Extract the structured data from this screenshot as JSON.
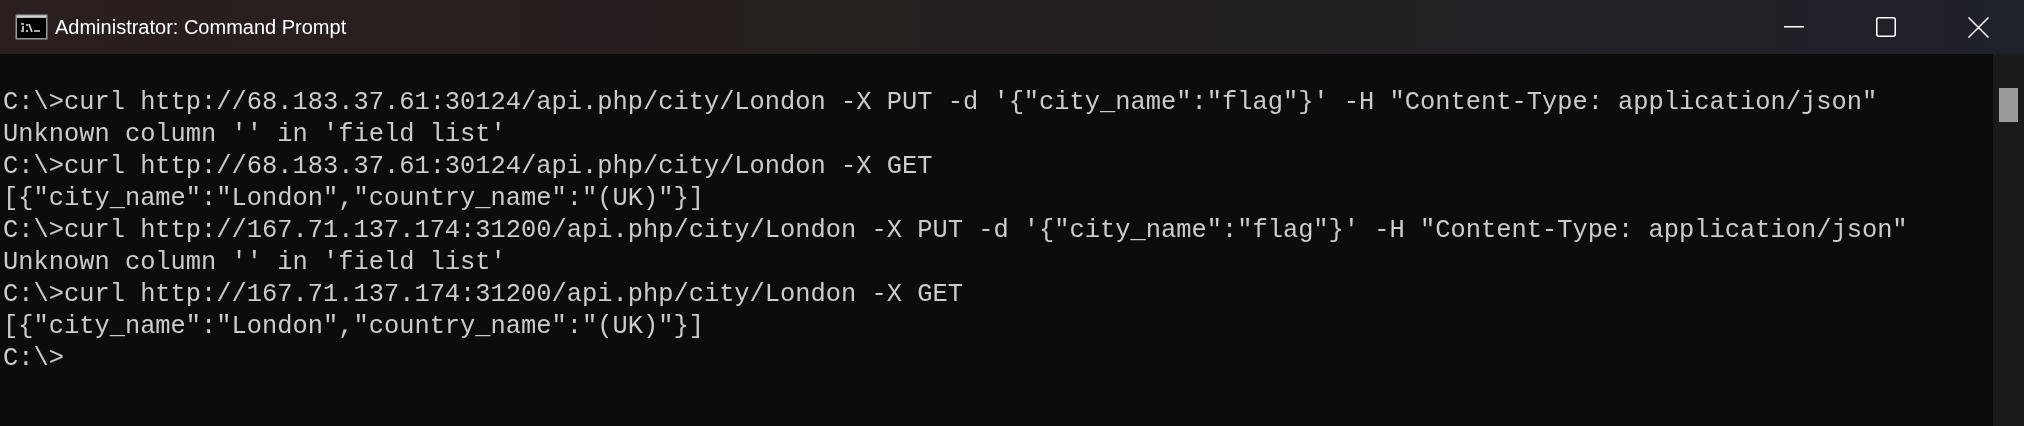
{
  "window": {
    "title": "Administrator: Command Prompt"
  },
  "console": {
    "lines": [
      "C:\\>curl http://68.183.37.61:30124/api.php/city/London -X PUT -d '{\"city_name\":\"flag\"}' -H \"Content-Type: application/json\"",
      "Unknown column '' in 'field list'",
      "C:\\>curl http://68.183.37.61:30124/api.php/city/London -X GET",
      "[{\"city_name\":\"London\",\"country_name\":\"(UK)\"}]",
      "C:\\>curl http://167.71.137.174:31200/api.php/city/London -X PUT -d '{\"city_name\":\"flag\"}' -H \"Content-Type: application/json\"",
      "Unknown column '' in 'field list'",
      "C:\\>curl http://167.71.137.174:31200/api.php/city/London -X GET",
      "[{\"city_name\":\"London\",\"country_name\":\"(UK)\"}]",
      "C:\\>"
    ]
  }
}
